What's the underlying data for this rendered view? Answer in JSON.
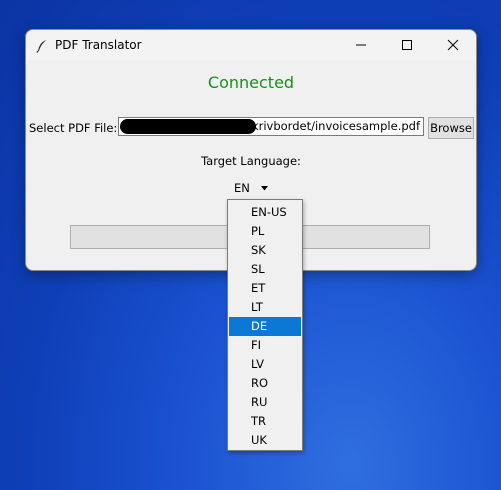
{
  "window": {
    "title": "PDF Translator",
    "icon": "feather-icon",
    "controls": [
      "minimize-icon",
      "maximize-icon",
      "close-icon"
    ]
  },
  "status": {
    "text": "Connected",
    "color": "#1a8f1a"
  },
  "file": {
    "label": "Select PDF File:",
    "value": "/Skrivbordet/invoicesample.pdf",
    "browse_label": "Browse"
  },
  "language": {
    "label": "Target Language:",
    "selected": "EN",
    "options": [
      "EN-US",
      "PL",
      "SK",
      "SL",
      "ET",
      "LT",
      "DE",
      "FI",
      "LV",
      "RO",
      "RU",
      "TR",
      "UK"
    ],
    "highlighted": "DE"
  },
  "translate_button": {
    "label": ""
  },
  "colors": {
    "accent": "#0a78d4",
    "desktop": "#1a52d0"
  }
}
